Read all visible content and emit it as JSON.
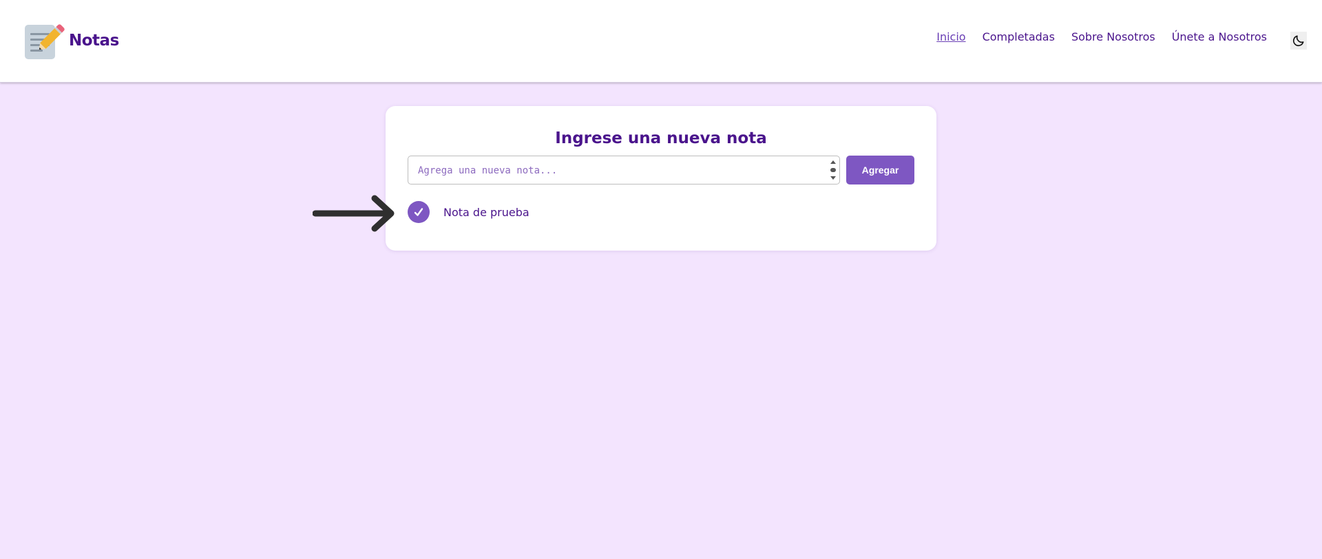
{
  "header": {
    "brand": "Notas",
    "logo_icon": "memo-pencil-icon",
    "nav": [
      {
        "label": "Inicio",
        "active": true
      },
      {
        "label": "Completadas",
        "active": false
      },
      {
        "label": "Sobre Nosotros",
        "active": false
      },
      {
        "label": "Únete a Nosotros",
        "active": false
      }
    ],
    "theme_toggle_icon": "moon-icon"
  },
  "card": {
    "title": "Ingrese una nueva nota",
    "input": {
      "placeholder": "Agrega una nueva nota...",
      "value": ""
    },
    "add_button_label": "Agregar",
    "notes": [
      {
        "text": "Nota de prueba",
        "completed": true
      }
    ]
  },
  "annotation": {
    "icon": "right-arrow-icon"
  },
  "colors": {
    "page_background": "#f3e4fe",
    "primary": "#7e57c2",
    "heading": "#4a148c",
    "card_background": "#ffffff"
  }
}
